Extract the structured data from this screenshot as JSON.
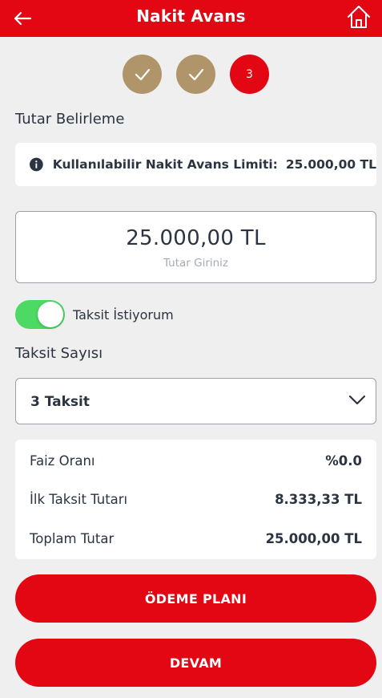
{
  "header": {
    "title": "Nakit Avans",
    "back_icon": "arrow-left-icon",
    "home_icon": "home-icon"
  },
  "steps": [
    {
      "state": "done",
      "icon": "check-icon"
    },
    {
      "state": "done",
      "icon": "check-icon"
    },
    {
      "state": "current",
      "label": "3"
    }
  ],
  "amount_section": {
    "title": "Tutar Belirleme",
    "limit_label": "Kullanılabilir Nakit Avans Limiti:",
    "limit_value": "25.000,00 TL",
    "amount_value": "25.000,00 TL",
    "amount_hint": "Tutar Giriniz"
  },
  "installment_toggle": {
    "label": "Taksit İstiyorum",
    "on": true
  },
  "installment": {
    "title": "Taksit Sayısı",
    "selected": "3 Taksit"
  },
  "details": [
    {
      "label": "Faiz Oranı",
      "value": "%0.0"
    },
    {
      "label": "İlk Taksit Tutarı",
      "value": "8.333,33 TL"
    },
    {
      "label": "Toplam Tutar",
      "value": "25.000,00 TL"
    }
  ],
  "buttons": {
    "payment_plan": "ÖDEME PLANI",
    "continue": "DEVAM"
  },
  "colors": {
    "brand": "#e30613",
    "step_done": "#b0946a",
    "toggle_on": "#4cd964"
  }
}
